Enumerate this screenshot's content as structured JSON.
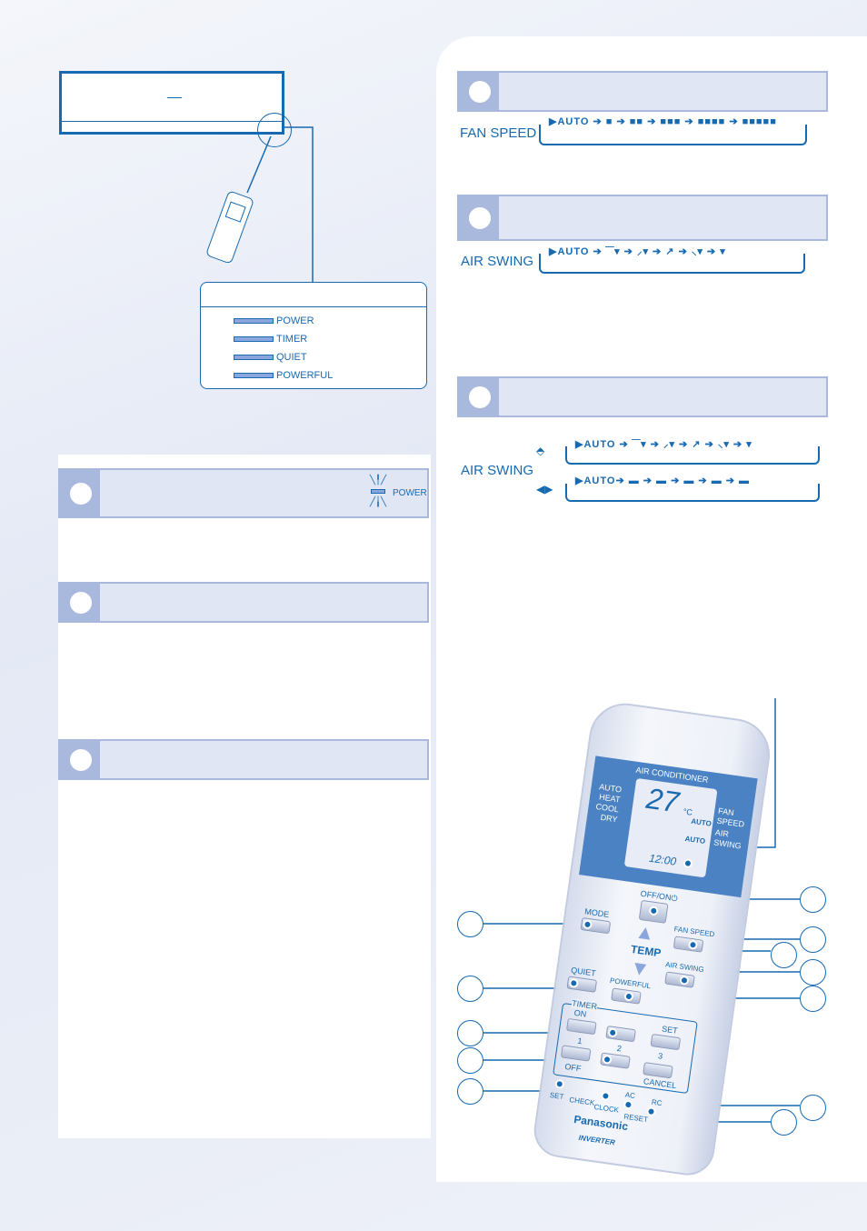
{
  "indicator_panel": {
    "items": [
      "POWER",
      "TIMER",
      "QUIET",
      "POWERFUL"
    ]
  },
  "left_sections": [
    {
      "icon_label": "POWER"
    },
    {},
    {}
  ],
  "fan_speed": {
    "label": "FAN SPEED",
    "sequence": "AUTO",
    "steps": [
      "■",
      "■■",
      "■■■",
      "■■■■",
      "■■■■■"
    ]
  },
  "air_swing": {
    "label": "AIR SWING",
    "sequence": "AUTO"
  },
  "air_swing_2": {
    "label": "AIR SWING",
    "sequence_v": "AUTO",
    "sequence_h": "AUTO"
  },
  "remote": {
    "band": "AIR CONDITIONER",
    "modes": [
      "AUTO",
      "HEAT",
      "COOL",
      "DRY"
    ],
    "temp": "27",
    "unit": "°C",
    "fan_auto": "AUTO",
    "swing_auto": "AUTO",
    "fan_label": "FAN SPEED",
    "swing_label": "AIR SWING",
    "clock": "12:00",
    "offon": "OFF/ON⏻",
    "mode": "MODE",
    "fanspeed": "FAN SPEED",
    "temp_label": "TEMP",
    "airswing": "AIR SWING",
    "quiet": "QUIET",
    "powerful": "POWERFUL",
    "timer": "TIMER",
    "on": "ON",
    "off": "OFF",
    "n1": "1",
    "n2": "2",
    "n3": "3",
    "set": "SET",
    "cancel": "CANCEL",
    "set2": "SET",
    "check": "CHECK",
    "clockbtn": "CLOCK",
    "ac": "AC",
    "rc": "RC",
    "reset": "RESET",
    "brand": "Panasonic",
    "inverter": "INVERTER"
  },
  "colors": {
    "accent": "#1769b0",
    "band": "#e0e6f4",
    "band_side": "#a9b9dd",
    "lcd_band": "#4b82c3"
  }
}
